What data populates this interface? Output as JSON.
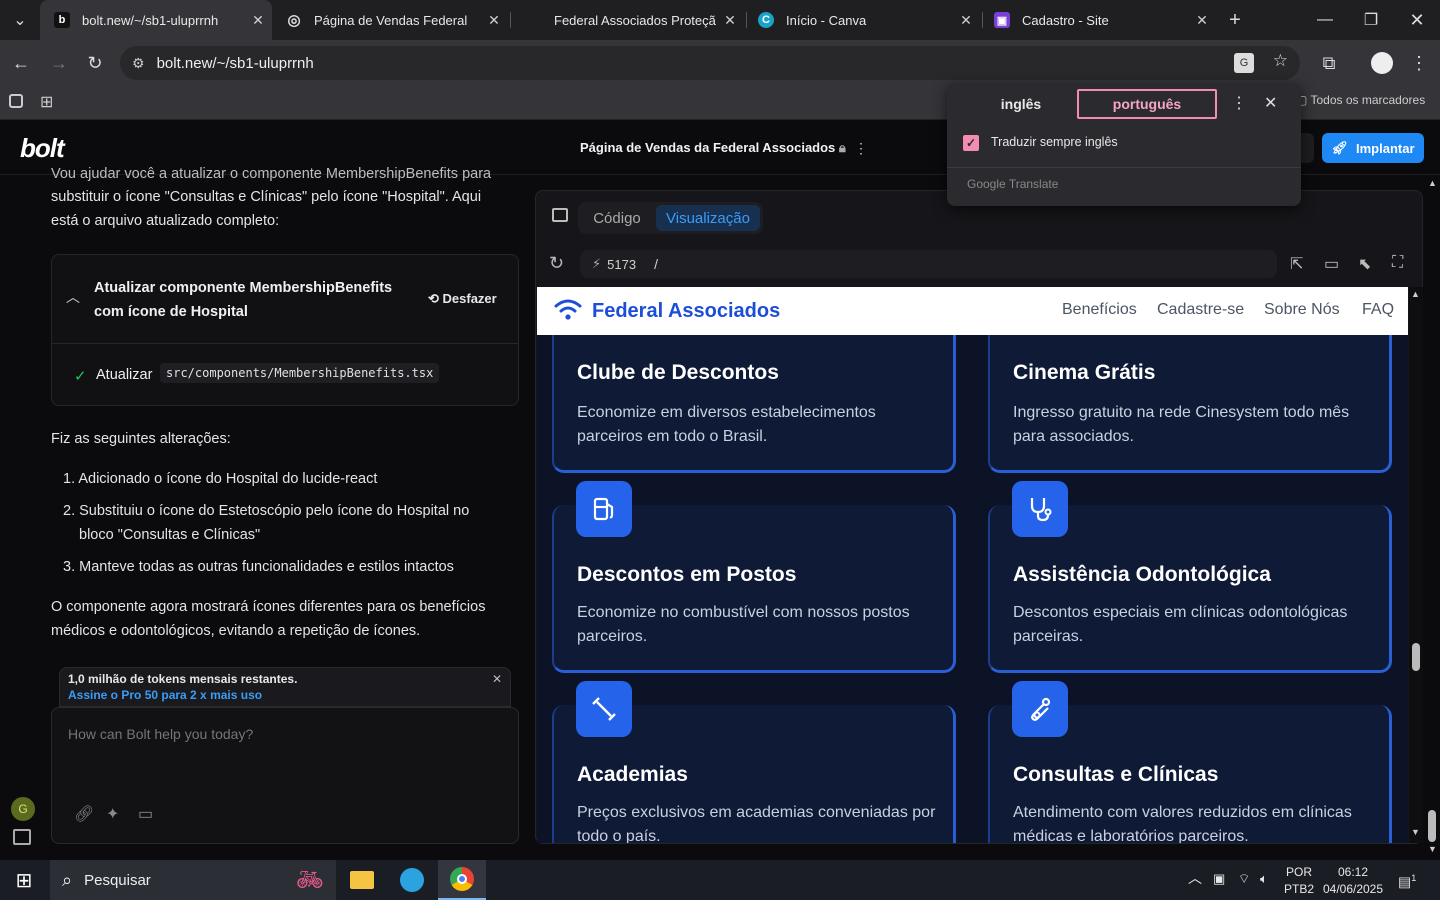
{
  "browser": {
    "tabs": [
      {
        "title": "bolt.new/~/sb1-uluprrnh",
        "favicon": "b"
      },
      {
        "title": "Página de Vendas Federal",
        "favicon": "◎"
      },
      {
        "title": "Federal Associados Proteção Ve",
        "favicon": ""
      },
      {
        "title": "Início - Canva",
        "favicon": "C"
      },
      {
        "title": "Cadastro - Site",
        "favicon": "▣"
      }
    ],
    "url": "bolt.new/~/sb1-uluprrnh",
    "bookmarks_label": "Todos os marcadores"
  },
  "translate_popup": {
    "source_lang": "inglês",
    "target_lang": "português",
    "always_translate_label": "Traduzir sempre inglês",
    "always_translate_checked": true,
    "provider": "Google",
    "provider_suffix": "Translate"
  },
  "bolt": {
    "logo": "bolt",
    "project_title": "Página de Vendas da Federal Associados",
    "deploy_label": "Implantar"
  },
  "chat": {
    "intro_line1": "Vou ajudar você a atualizar o componente MembershipBenefits para",
    "intro_line2": "substituir o ícone \"Consultas e Clínicas\" pelo ícone \"Hospital\". Aqui",
    "intro_line3": "está o arquivo atualizado completo:",
    "action_title_line1": "Atualizar componente MembershipBenefits",
    "action_title_line2": "com ícone de Hospital",
    "undo_label": "Desfazer",
    "update_label": "Atualizar",
    "file_path": "src/components/MembershipBenefits.tsx",
    "changes_heading": "Fiz as seguintes alterações:",
    "changes": [
      {
        "num": "1.",
        "line1": "Adicionado o ícone do Hospital do lucide-react",
        "line2": ""
      },
      {
        "num": "2.",
        "line1": "Substituiu o ícone do Estetoscópio pelo ícone do Hospital no",
        "line2": "bloco \"Consultas e Clínicas\""
      },
      {
        "num": "3.",
        "line1": "Manteve todas as outras funcionalidades e estilos intactos",
        "line2": ""
      }
    ],
    "summary_line1": "O componente agora mostrará ícones diferentes para os benefícios",
    "summary_line2": "médicos e odontológicos, evitando a repetição de ícones.",
    "tokens_text": "1,0 milhão de tokens mensais restantes.",
    "tokens_link": "Assine o Pro 50 para 2 x mais uso",
    "prompt_placeholder": "How can Bolt help you today?",
    "user_avatar": "G"
  },
  "workbench": {
    "tab_code": "Código",
    "tab_preview": "Visualização",
    "port": "5173",
    "path": "/"
  },
  "site": {
    "brand": "Federal Associados",
    "nav": [
      "Benefícios",
      "Cadastre-se",
      "Sobre Nós",
      "FAQ"
    ],
    "cards": [
      {
        "title": "Clube de Descontos",
        "desc_line1": "Economize em diversos estabelecimentos",
        "desc_line2": "parceiros em todo o Brasil.",
        "icon": "tag-icon"
      },
      {
        "title": "Cinema Grátis",
        "desc_line1": "Ingresso gratuito na rede Cinesystem todo mês",
        "desc_line2": "para associados.",
        "icon": "film-icon"
      },
      {
        "title": "Descontos em Postos",
        "desc_line1": "Economize no combustível com nossos postos",
        "desc_line2": "parceiros.",
        "icon": "fuel-icon"
      },
      {
        "title": "Assistência Odontológica",
        "desc_line1": "Descontos especiais em clínicas odontológicas",
        "desc_line2": "parceiras.",
        "icon": "stethoscope-icon"
      },
      {
        "title": "Academias",
        "desc_line1": "Preços exclusivos em academias conveniadas por",
        "desc_line2": "todo o país.",
        "icon": "dumbbell-icon"
      },
      {
        "title": "Consultas e Clínicas",
        "desc_line1": "Atendimento com valores reduzidos em clínicas",
        "desc_line2": "médicas e laboratórios parceiros.",
        "icon": "stethoscope-icon"
      }
    ]
  },
  "taskbar": {
    "search_label": "Pesquisar",
    "lang_line1": "POR",
    "lang_line2": "PTB2",
    "time": "06:12",
    "date": "04/06/2025",
    "notifications": "1"
  },
  "colors": {
    "accent": "#1e88f5",
    "site_bg": "#0c1326",
    "card_icon": "#2563eb",
    "brand_blue": "#1d4ed8"
  }
}
